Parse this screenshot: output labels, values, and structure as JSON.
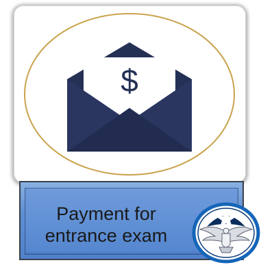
{
  "caption": {
    "line1": "Payment for",
    "line2": "entrance exam"
  },
  "icons": {
    "main": "dollar-envelope-icon",
    "emblem": "eagle-star-emblem-icon"
  },
  "colors": {
    "envelope": "#253055",
    "ring": "#c9a24a",
    "caption_bg": "#5e8fd3",
    "emblem_ring": "#1565b8"
  },
  "symbols": {
    "currency": "$"
  }
}
